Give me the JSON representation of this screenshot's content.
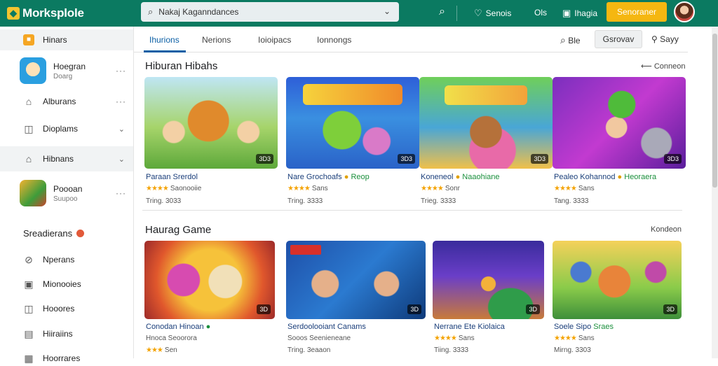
{
  "app": {
    "title": "Morksplole"
  },
  "search": {
    "value": "Nakaj Kaganndances"
  },
  "topbar": {
    "link1": "Senois",
    "link2": "Ols",
    "link3": "Ihagia",
    "signin": "Senoraner"
  },
  "sidebar": {
    "items": [
      {
        "label": "Hinars"
      },
      {
        "label": "Hoegran",
        "sub": "Doarg"
      },
      {
        "label": "Alburans"
      },
      {
        "label": "Dioplams"
      },
      {
        "label": "Hibnans"
      },
      {
        "label": "Poooan",
        "sub": "Suupoo"
      }
    ],
    "section_heading": "Sreadierans",
    "section_items": [
      {
        "label": "Nperans"
      },
      {
        "label": "Mionooies"
      },
      {
        "label": "Hooores"
      },
      {
        "label": "Hiiraiins"
      },
      {
        "label": "Hoorrares"
      }
    ]
  },
  "tabs": [
    {
      "label": "Ihurions"
    },
    {
      "label": "Nerions"
    },
    {
      "label": "Ioioipacs"
    },
    {
      "label": "Ionnongs"
    }
  ],
  "toolbar": {
    "search_label": "Ble",
    "button_label": "Gsrovav",
    "save_label": "Sayy"
  },
  "sections": [
    {
      "title": "Hiburan Hibahs",
      "link": "Conneon",
      "cards": [
        {
          "title": "Paraan Srerdol",
          "tag": "",
          "rating_text": "Saonooiie",
          "meta": "Tring. 3033",
          "badge": "3D3"
        },
        {
          "title": "Nare Grochoafs",
          "tag": "Reop",
          "rating_text": "Sans",
          "meta": "Tring. 3333",
          "badge": "3D3"
        },
        {
          "title": "Koneneol",
          "tag": "Naaohiane",
          "rating_text": "Sonr",
          "meta": "Trieg. 3333",
          "badge": "3D3"
        },
        {
          "title": "Pealeo Kohannod",
          "tag": "Heoraera",
          "rating_text": "Sans",
          "meta": "Tang. 3333",
          "badge": "3D3"
        }
      ]
    },
    {
      "title": "Haurag Game",
      "link": "Kondeon",
      "cards": [
        {
          "title": "Conodan Hinoan",
          "tag": "",
          "rating_text": "",
          "meta_line1": "Hnoca Seoorora",
          "meta": "Sen",
          "badge": "3D"
        },
        {
          "title": "Serdoolooiant Canams",
          "tag": "",
          "rating_text": "",
          "meta_line1": "Sooos Seenieneane",
          "meta": "Tring. 3eaaon",
          "badge": "3D"
        },
        {
          "title": "Nerrane Ete Kiolaica",
          "tag": "",
          "rating_text": "Sans",
          "meta": "Tiing. 3333",
          "badge": "3D"
        },
        {
          "title": "Soele Sipo",
          "tag": "Sraes",
          "rating_text": "Sans",
          "meta": "Mirng. 3303",
          "badge": "3D"
        }
      ]
    }
  ],
  "colors": {
    "brand": "#0b7a61",
    "accent": "#f5b711",
    "link": "#1a3e7a",
    "tab_active": "#0b5fa5"
  }
}
